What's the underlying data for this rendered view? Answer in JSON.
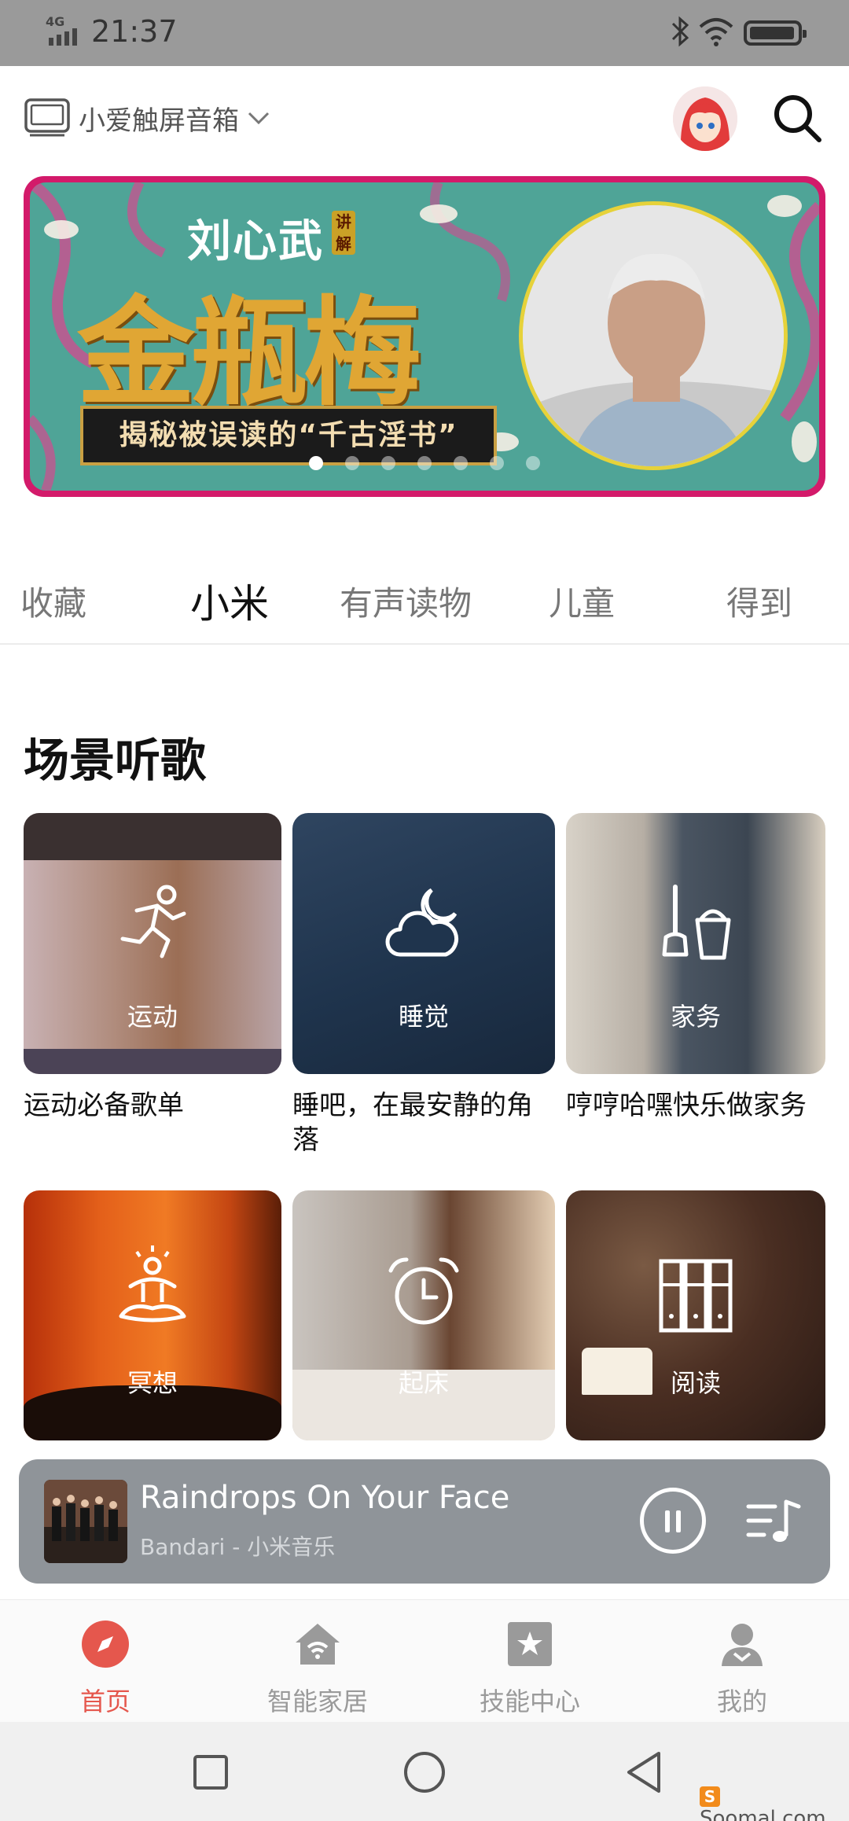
{
  "status_bar": {
    "network": "4G",
    "time": "21:37"
  },
  "header": {
    "device_name": "小爱触屏音箱"
  },
  "banner": {
    "author": "刘心武",
    "author_badge": "讲解",
    "title": "金瓶梅",
    "subtitle": "揭秘被误读的“千古淫书”",
    "active_dot": 0,
    "dot_count": 7
  },
  "tabs": [
    {
      "label": "收藏"
    },
    {
      "label": "小米"
    },
    {
      "label": "有声读物"
    },
    {
      "label": "儿童"
    },
    {
      "label": "得到"
    }
  ],
  "active_tab": "小米",
  "section": {
    "title": "场景听歌"
  },
  "scenes": [
    {
      "label": "运动",
      "caption": "运动必备歌单",
      "icon": "running-icon"
    },
    {
      "label": "睡觉",
      "caption": "睡吧，在最安静的角落",
      "icon": "moon-cloud-icon"
    },
    {
      "label": "家务",
      "caption": "哼哼哈嘿快乐做家务",
      "icon": "mop-bucket-icon"
    },
    {
      "label": "冥想",
      "caption": "",
      "icon": "meditation-icon"
    },
    {
      "label": "起床",
      "caption": "",
      "icon": "alarm-clock-icon"
    },
    {
      "label": "阅读",
      "caption": "",
      "icon": "bookshelf-icon"
    }
  ],
  "player": {
    "title": "Raindrops On Your Face",
    "artist": "Bandari - 小米音乐",
    "state": "playing"
  },
  "bottom_nav": [
    {
      "label": "首页",
      "icon": "compass-icon",
      "active": true
    },
    {
      "label": "智能家居",
      "icon": "smart-home-icon",
      "active": false
    },
    {
      "label": "技能中心",
      "icon": "skill-star-icon",
      "active": false
    },
    {
      "label": "我的",
      "icon": "profile-icon",
      "active": false
    }
  ],
  "watermark": "Soomal.com",
  "colors": {
    "accent": "#e5574d",
    "banner_frame": "#d31a6a",
    "banner_bg": "#4fa497",
    "player_bg": "#8f9499"
  }
}
